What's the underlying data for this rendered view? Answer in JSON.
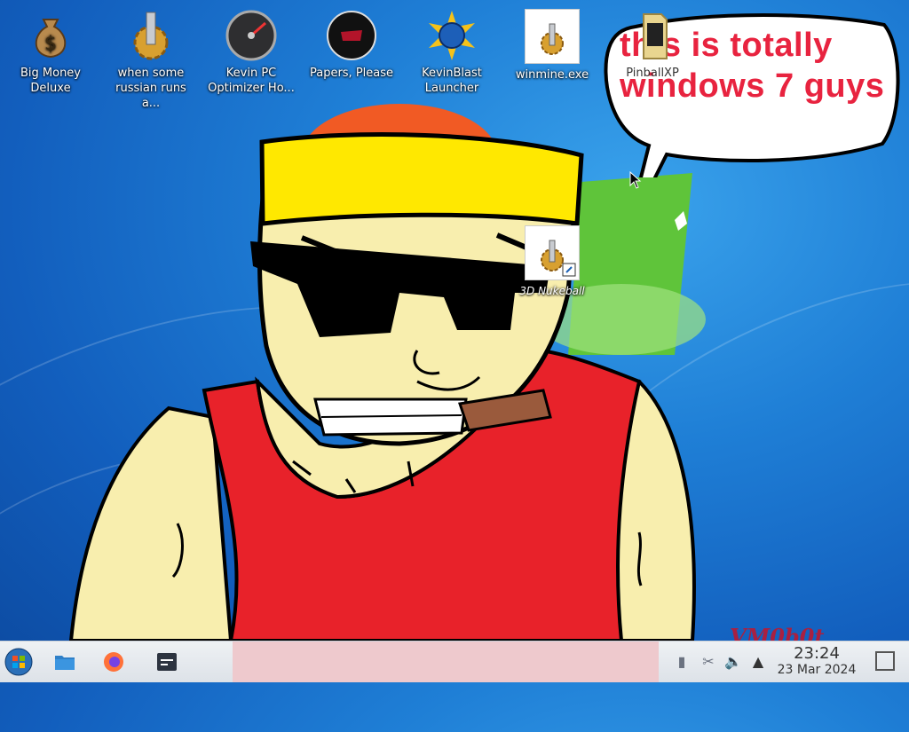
{
  "desktop": {
    "icons": [
      {
        "label": "Big Money Deluxe",
        "icon": "money-bag-icon"
      },
      {
        "label": "when some russian runs a...",
        "icon": "gear-icon"
      },
      {
        "label": "Kevin PC Optimizer Ho...",
        "icon": "speedometer-icon"
      },
      {
        "label": "Papers, Please",
        "icon": "papers-please-icon"
      },
      {
        "label": "KevinBlast Launcher",
        "icon": "globe-burst-icon"
      },
      {
        "label": "winmine.exe",
        "icon": "gear-icon"
      },
      {
        "label": "PinballXP",
        "icon": "folder-icon"
      },
      {
        "label": "3D Nukeball",
        "icon": "gear-shortcut-icon"
      }
    ],
    "speech_bubble": {
      "line1": "this is totally",
      "line2": "windows 7 guys"
    },
    "watermark": "VM0b0t"
  },
  "taskbar": {
    "start": {
      "icon": "windows-orb-icon"
    },
    "pinned": [
      {
        "icon": "file-manager-icon"
      },
      {
        "icon": "firefox-icon"
      },
      {
        "icon": "terminal-icon"
      }
    ],
    "tray": [
      {
        "icon": "usb-drive-icon"
      },
      {
        "icon": "scissors-icon"
      },
      {
        "icon": "volume-icon"
      },
      {
        "icon": "tray-expand-icon"
      }
    ],
    "clock": {
      "time": "23:24",
      "date": "23 Mar 2024"
    }
  },
  "colors": {
    "bubble_text": "#e8233f",
    "shirt": "#e8222a",
    "skin": "#f8eeae",
    "headband": "#ffe800"
  }
}
